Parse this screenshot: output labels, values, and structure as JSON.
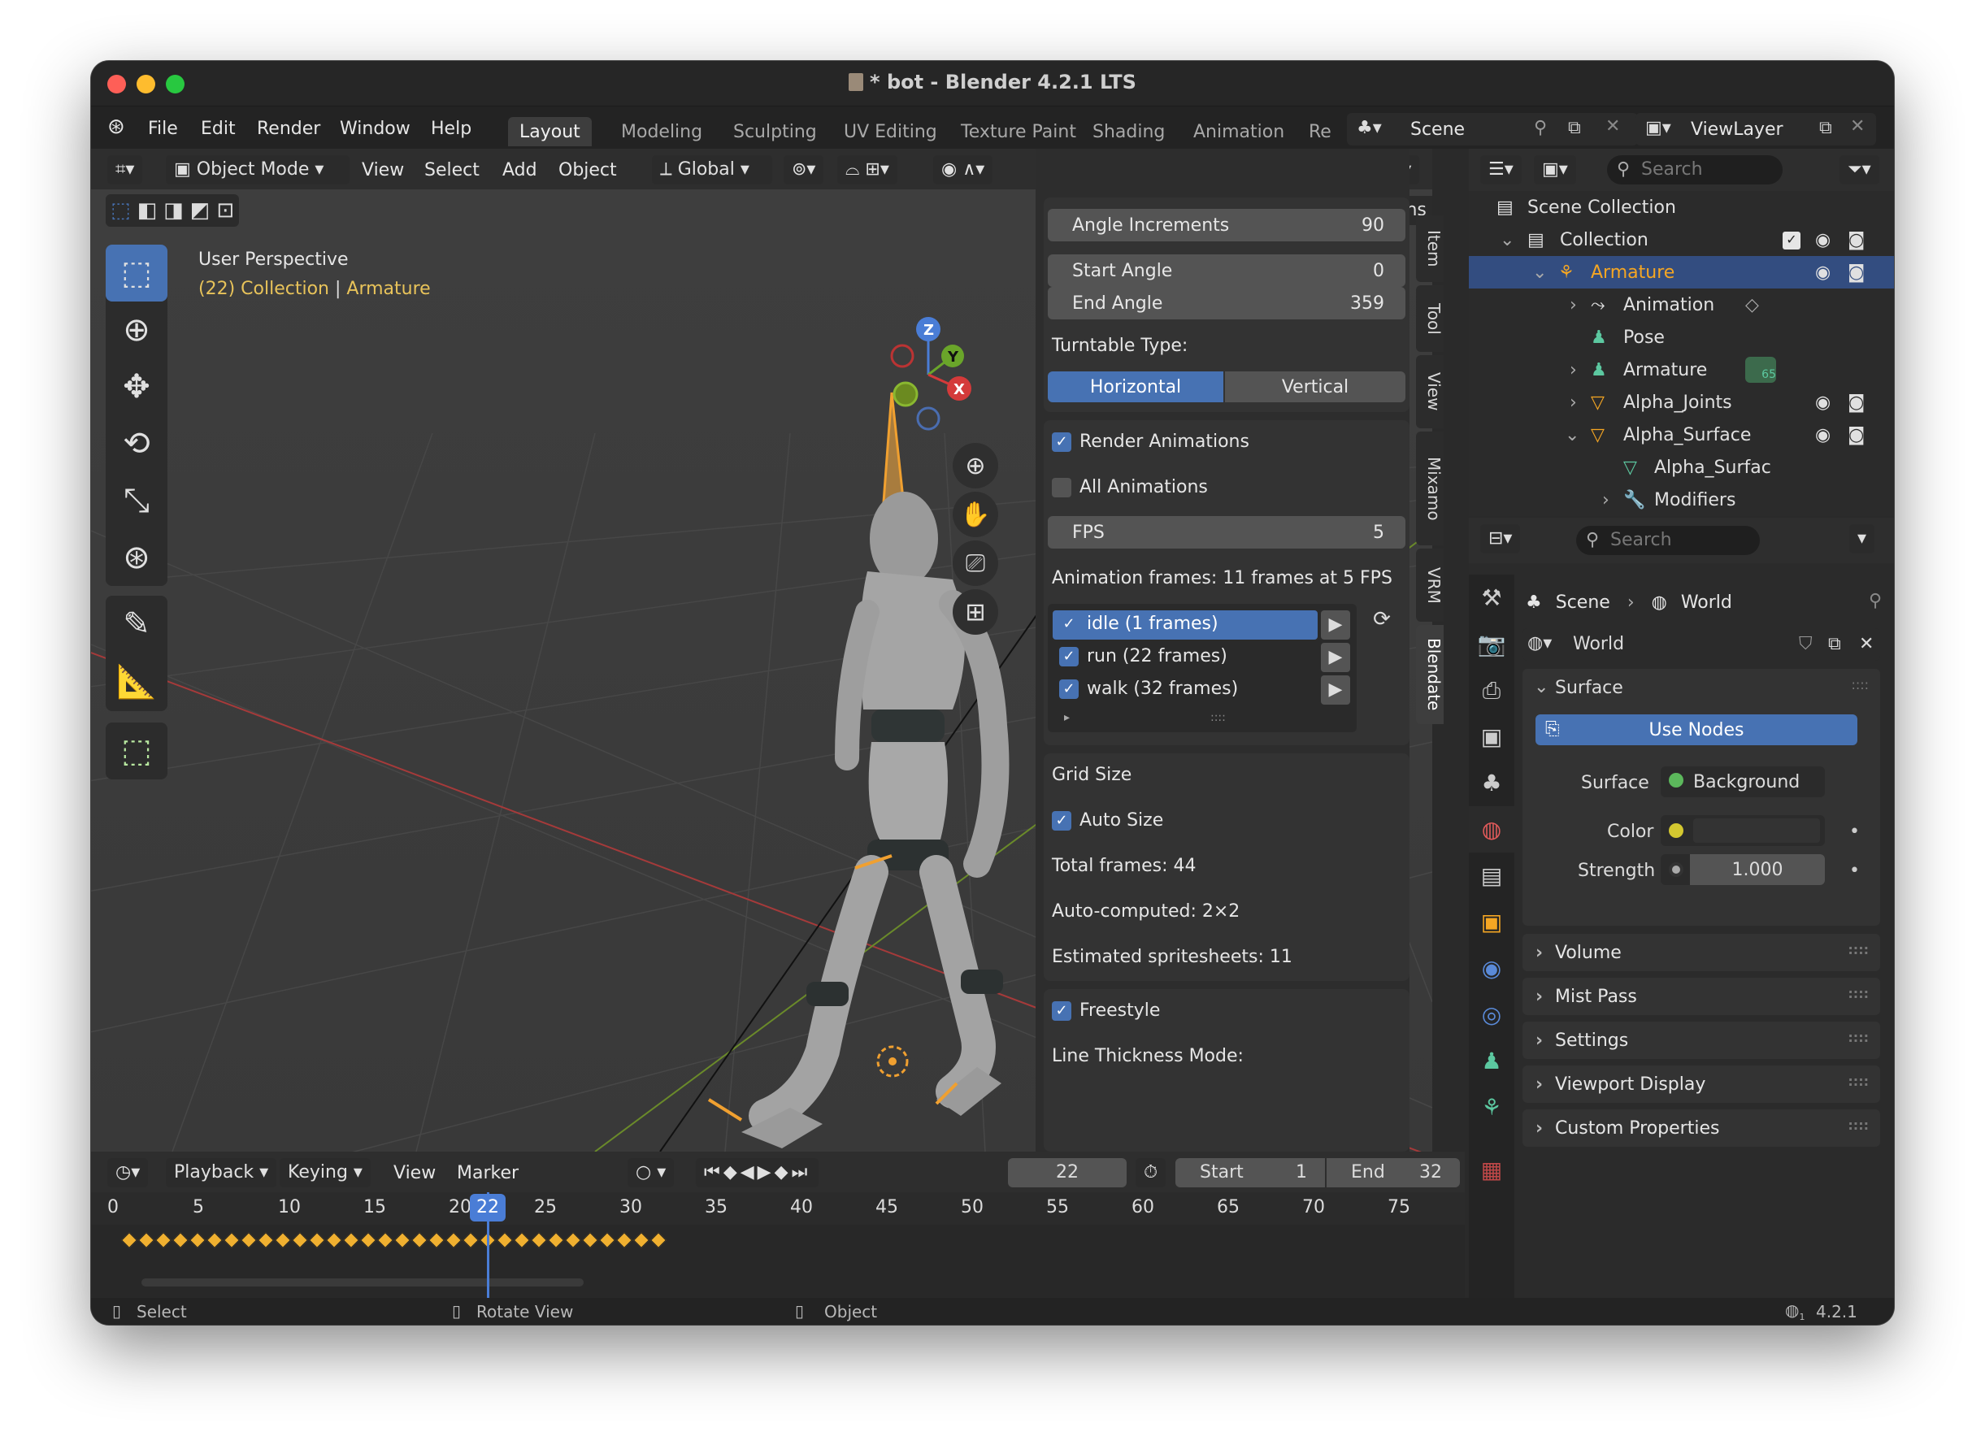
{
  "window": {
    "title": "* bot - Blender 4.2.1 LTS"
  },
  "menubar": {
    "file": "File",
    "edit": "Edit",
    "render": "Render",
    "window": "Window",
    "help": "Help",
    "workspaces": [
      "Layout",
      "Modeling",
      "Sculpting",
      "UV Editing",
      "Texture Paint",
      "Shading",
      "Animation",
      "Re"
    ],
    "scene": "Scene",
    "view_layer": "ViewLayer"
  },
  "viewport": {
    "mode": "Object Mode",
    "view": "View",
    "select": "Select",
    "add": "Add",
    "object": "Object",
    "orientation": "Global",
    "options": "Options",
    "overlay_title": "User Perspective",
    "overlay_info_frame": "(22) Collection",
    "overlay_info_sep": "|",
    "overlay_info_obj": "Armature",
    "gizmo": {
      "z": "Z",
      "y": "Y",
      "x": "X"
    }
  },
  "blendate": {
    "angle_increments_label": "Angle Increments",
    "angle_increments_value": "90",
    "start_angle_label": "Start Angle",
    "start_angle_value": "0",
    "end_angle_label": "End Angle",
    "end_angle_value": "359",
    "turntable_type_label": "Turntable Type:",
    "turntable_horizontal": "Horizontal",
    "turntable_vertical": "Vertical",
    "render_animations": "Render Animations",
    "all_animations": "All Animations",
    "fps_label": "FPS",
    "fps_value": "5",
    "animation_frames": "Animation frames: 11 frames at 5 FPS",
    "animations": [
      {
        "label": "idle (1 frames)",
        "checked": true,
        "selected": true
      },
      {
        "label": "run (22 frames)",
        "checked": true,
        "selected": false
      },
      {
        "label": "walk (32 frames)",
        "checked": true,
        "selected": false
      }
    ],
    "grid_size": "Grid Size",
    "auto_size": "Auto Size",
    "total_frames": "Total frames: 44",
    "auto_computed": "Auto-computed: 2×2",
    "estimated": "Estimated spritesheets: 11",
    "freestyle": "Freestyle",
    "line_thickness": "Line Thickness Mode:"
  },
  "sidebar_tabs": [
    "Item",
    "Tool",
    "View",
    "Mixamo",
    "VRM",
    "Blendate"
  ],
  "timeline": {
    "playback": "Playback",
    "keying": "Keying",
    "view": "View",
    "marker": "Marker",
    "current_frame": "22",
    "start_label": "Start",
    "start_value": "1",
    "end_label": "End",
    "end_value": "32",
    "ruler": [
      "0",
      "5",
      "10",
      "15",
      "20",
      "25",
      "30",
      "35",
      "40",
      "45",
      "50",
      "55",
      "60",
      "65",
      "70",
      "75"
    ],
    "playhead": "22",
    "keyframe_count": 32
  },
  "outliner": {
    "search_placeholder": "Search",
    "rows": [
      {
        "label": "Scene Collection"
      },
      {
        "label": "Collection"
      },
      {
        "label": "Armature"
      },
      {
        "label": "Animation"
      },
      {
        "label": "Pose"
      },
      {
        "label": "Armature"
      },
      {
        "label": "Alpha_Joints"
      },
      {
        "label": "Alpha_Surface"
      },
      {
        "label": "Alpha_Surfac"
      },
      {
        "label": "Modifiers"
      }
    ],
    "armature_badge": "65"
  },
  "properties": {
    "search_placeholder": "Search",
    "breadcrumb_scene": "Scene",
    "breadcrumb_world": "World",
    "world_name": "World",
    "surface_section": "Surface",
    "use_nodes": "Use Nodes",
    "surface_label": "Surface",
    "surface_value": "Background",
    "color_label": "Color",
    "strength_label": "Strength",
    "strength_value": "1.000",
    "sections": [
      "Volume",
      "Mist Pass",
      "Settings",
      "Viewport Display",
      "Custom Properties"
    ]
  },
  "statusbar": {
    "select": "Select",
    "rotate": "Rotate View",
    "object": "Object",
    "version": "4.2.1",
    "version_icon_sub": "1"
  },
  "colors": {
    "accent": "#4772b3",
    "active_text": "#f5a623",
    "overlay_yellow": "#e8c35a"
  }
}
